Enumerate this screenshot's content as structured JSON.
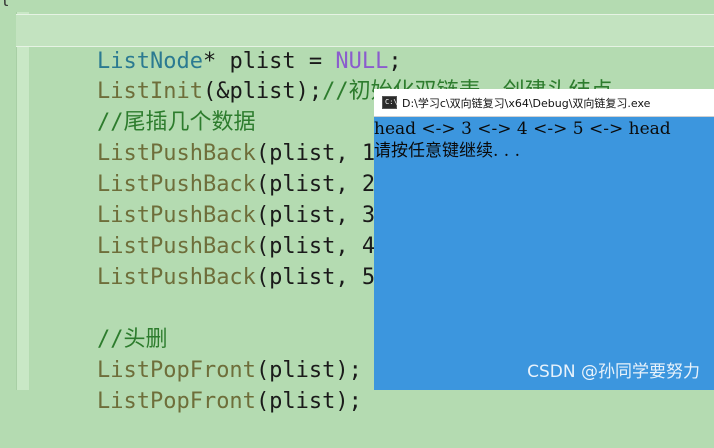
{
  "editor": {
    "brace": "{",
    "lines": [
      {
        "tokens": [
          "ListNode",
          "* plist = ",
          "NULL",
          ";"
        ]
      },
      {
        "tokens": [
          "ListInit",
          "(&plist);",
          "//初始化双链表，创建头结点"
        ]
      },
      {
        "tokens": [
          "//尾插几个数据"
        ]
      },
      {
        "tokens": [
          "ListPushBack",
          "(plist, 1);"
        ]
      },
      {
        "tokens": [
          "ListPushBack",
          "(plist, 2);"
        ]
      },
      {
        "tokens": [
          "ListPushBack",
          "(plist, 3);"
        ]
      },
      {
        "tokens": [
          "ListPushBack",
          "(plist, 4);"
        ]
      },
      {
        "tokens": [
          "ListPushBack",
          "(plist, 5);"
        ]
      },
      {
        "tokens": [
          ""
        ]
      },
      {
        "tokens": [
          "//头删"
        ]
      },
      {
        "tokens": [
          "ListPopFront",
          "(plist);"
        ]
      },
      {
        "tokens": [
          "ListPopFront",
          "(plist);"
        ]
      }
    ]
  },
  "console": {
    "icon_label": "C:\\",
    "icon": "console-app-icon",
    "title": "D:\\学习c\\双向链复习\\x64\\Debug\\双向链复习.exe",
    "output": [
      "head <-> 3 <-> 4 <-> 5 <-> head",
      "请按任意键继续. . ."
    ],
    "background": "#3c96de"
  },
  "watermark": "CSDN @孙同学要努力",
  "colors": {
    "editor_bg": "#b4dbb1",
    "function": "#6e6e3a",
    "type": "#2b7a91",
    "macro": "#8b5ccd",
    "comment": "#2d7c2d"
  }
}
